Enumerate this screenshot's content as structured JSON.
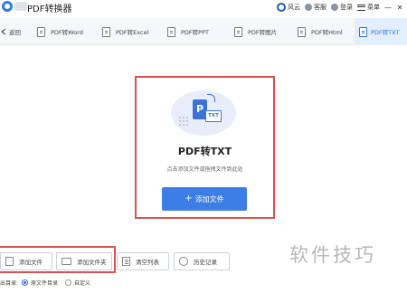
{
  "window": {
    "title": "PDF转换器",
    "header_items": [
      {
        "label": "风云",
        "icon": "logo-circle-icon"
      },
      {
        "label": "客服",
        "icon": "headset-icon"
      },
      {
        "label": "登录",
        "icon": "user-icon"
      },
      {
        "label": "菜单",
        "icon": "menu-icon"
      }
    ],
    "controls": {
      "minimize": "—",
      "close": "✕"
    }
  },
  "tabs": [
    {
      "label": "返回",
      "icon": "back-arrow-icon"
    },
    {
      "label": "PDF转Word",
      "icon": "document-icon"
    },
    {
      "label": "PDF转Excel",
      "icon": "document-icon"
    },
    {
      "label": "PDF转PPT",
      "icon": "document-icon"
    },
    {
      "label": "PDF转图片",
      "icon": "document-icon"
    },
    {
      "label": "PDF转Html",
      "icon": "document-icon"
    },
    {
      "label": "PDF转TXT",
      "icon": "document-icon",
      "active": true
    }
  ],
  "dropzone": {
    "title": "PDF转TXT",
    "hint": "点击添加文件或拖拽文件到此处",
    "add_button": "添加文件",
    "illustration": {
      "doc_letter": "P",
      "target_label": "TXT"
    }
  },
  "toolbar": {
    "add_file": "添加文件",
    "add_folder": "添加文件夹",
    "clear_list": "清空列表",
    "history": "历史记录"
  },
  "output": {
    "label": "出目录:",
    "options": [
      {
        "label": "原文件目录",
        "checked": true
      },
      {
        "label": "自定义",
        "checked": false
      }
    ]
  },
  "watermark": "软件技巧",
  "colors": {
    "accent": "#3d7ee6",
    "highlight_border": "#d9534f",
    "active_tab_bg": "#e3efff"
  }
}
